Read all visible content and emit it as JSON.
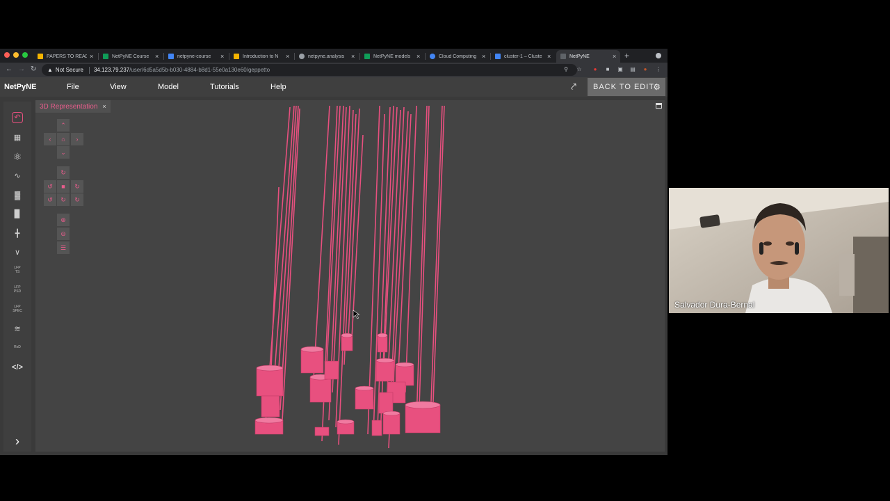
{
  "browser": {
    "tabs": [
      {
        "label": "PAPERS TO READ",
        "color": "#f5b400"
      },
      {
        "label": "NetPyNE Course",
        "color": "#0f9d58"
      },
      {
        "label": "netpyne-course",
        "color": "#4285f4"
      },
      {
        "label": "Introduction to N",
        "color": "#f4b400"
      },
      {
        "label": "netpyne.analysis",
        "color": "#9aa0a6"
      },
      {
        "label": "NetPyNE models",
        "color": "#0f9d58"
      },
      {
        "label": "Cloud Computing",
        "color": "#4285f4"
      },
      {
        "label": "cluster-1 – Cluste",
        "color": "#4285f4"
      },
      {
        "label": "NetPyNE",
        "color": "#5f6368"
      }
    ],
    "tab_close_glyph": "×",
    "new_tab_glyph": "+",
    "url": {
      "security_label": "Not Secure",
      "host": "34.123.79.237",
      "path": "/user/6d5a5d5b-b030-4884-b8d1-55e0a130e60/geppetto"
    }
  },
  "app": {
    "brand": "NetPyNE",
    "menu": [
      "File",
      "View",
      "Model",
      "Tutorials",
      "Help"
    ],
    "back_button": "BACK TO EDIT",
    "panel_tab": "3D Representation",
    "panel_close": "×",
    "sidebar_labels": [
      "LFP\nTS",
      "LFP\nPSD",
      "LFP\nSPEC",
      "RxD"
    ],
    "expand_glyph": "›",
    "accent_color": "#e8507f",
    "panel_bg": "#444444"
  },
  "video": {
    "participant_name": "Salvador Dura-Bernal"
  }
}
